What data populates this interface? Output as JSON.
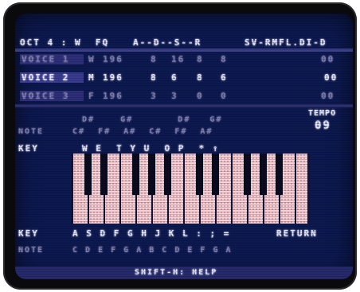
{
  "header": {
    "voice_label": "OCT 4 : W  FQ",
    "adsr_label": "A--D--S--R",
    "sustain_label": "SV-RMFL.DI-D"
  },
  "voices": [
    {
      "name": "VOICE 1",
      "wave": "W",
      "freq": "196",
      "a": "8",
      "d": "16",
      "s": "8",
      "r": "8",
      "extra": "00"
    },
    {
      "name": "VOICE 2",
      "wave": "M",
      "freq": "196",
      "a": "8",
      "d": "6",
      "s": "8",
      "r": "6",
      "extra": "00"
    },
    {
      "name": "VOICE 3",
      "wave": "F",
      "freq": "196",
      "a": "3",
      "d": "3",
      "s": "0",
      "r": "0",
      "extra": "00"
    }
  ],
  "tempo": {
    "label": "TEMPO",
    "value": "09"
  },
  "upper_notes": {
    "label": "NOTE",
    "sharps_top": "D#    G#       D#   G#",
    "sharps_bottom": "C#  F#  A#  C#  F#  A#"
  },
  "upper_keys": {
    "label": "KEY",
    "keys": "W E  T Y U  O P  * ↑"
  },
  "lower_keys": {
    "label": "KEY",
    "keys": "A S D F G H J K L : ; =",
    "return_label": "RETURN"
  },
  "lower_notes": {
    "label": "NOTE",
    "notes": "C D E F G A B C D E F G A"
  },
  "help": {
    "text": "SHIFT-H: HELP"
  },
  "colors": {
    "screen": "#0d1a52",
    "text": "#e8e8ff",
    "white_keys": "#f3d2d8",
    "black_keys": "#0b0b20"
  }
}
